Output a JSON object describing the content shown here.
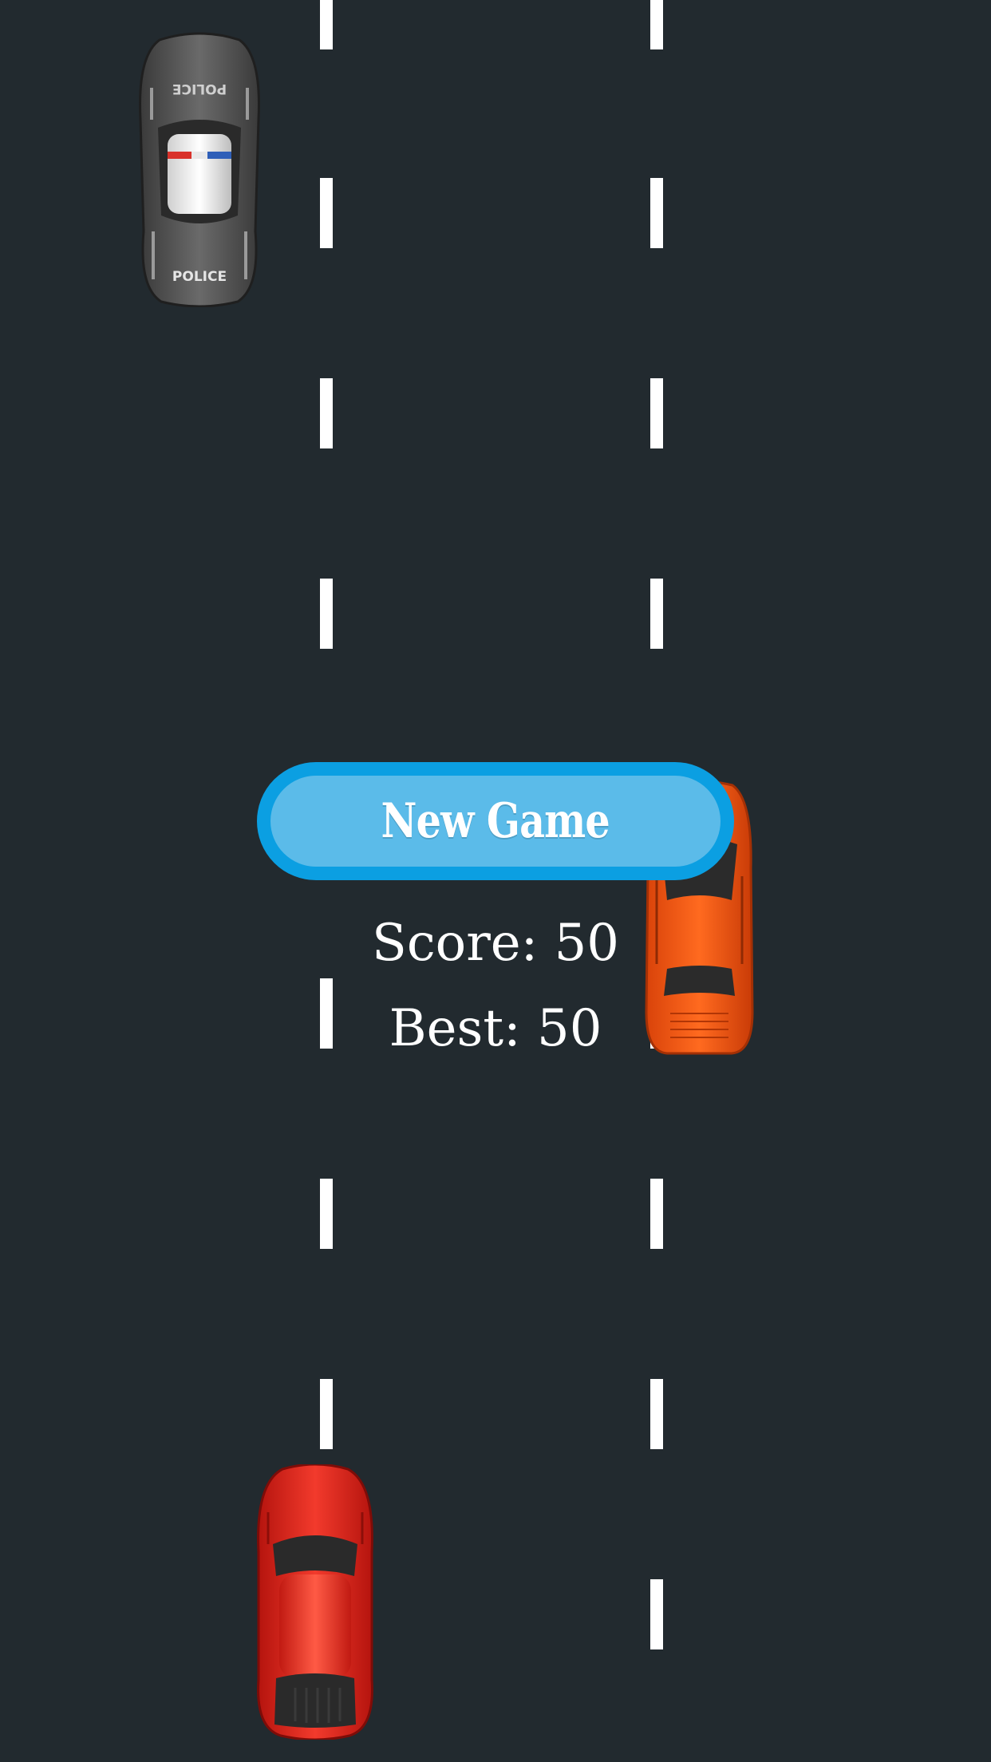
{
  "game": {
    "new_game_label": "New Game",
    "score_text": "Score: 50",
    "best_text": "Best: 50"
  },
  "vehicles": {
    "police_car": {
      "rear_text": "POLICE",
      "hood_text": "POLICE"
    }
  },
  "colors": {
    "road": "#222a2f",
    "lane_marking": "#ffffff",
    "button_fill": "#5bbbe9",
    "button_border": "#0b9fe2",
    "player_car": "#e4231b",
    "orange_car": "#f7560c"
  }
}
